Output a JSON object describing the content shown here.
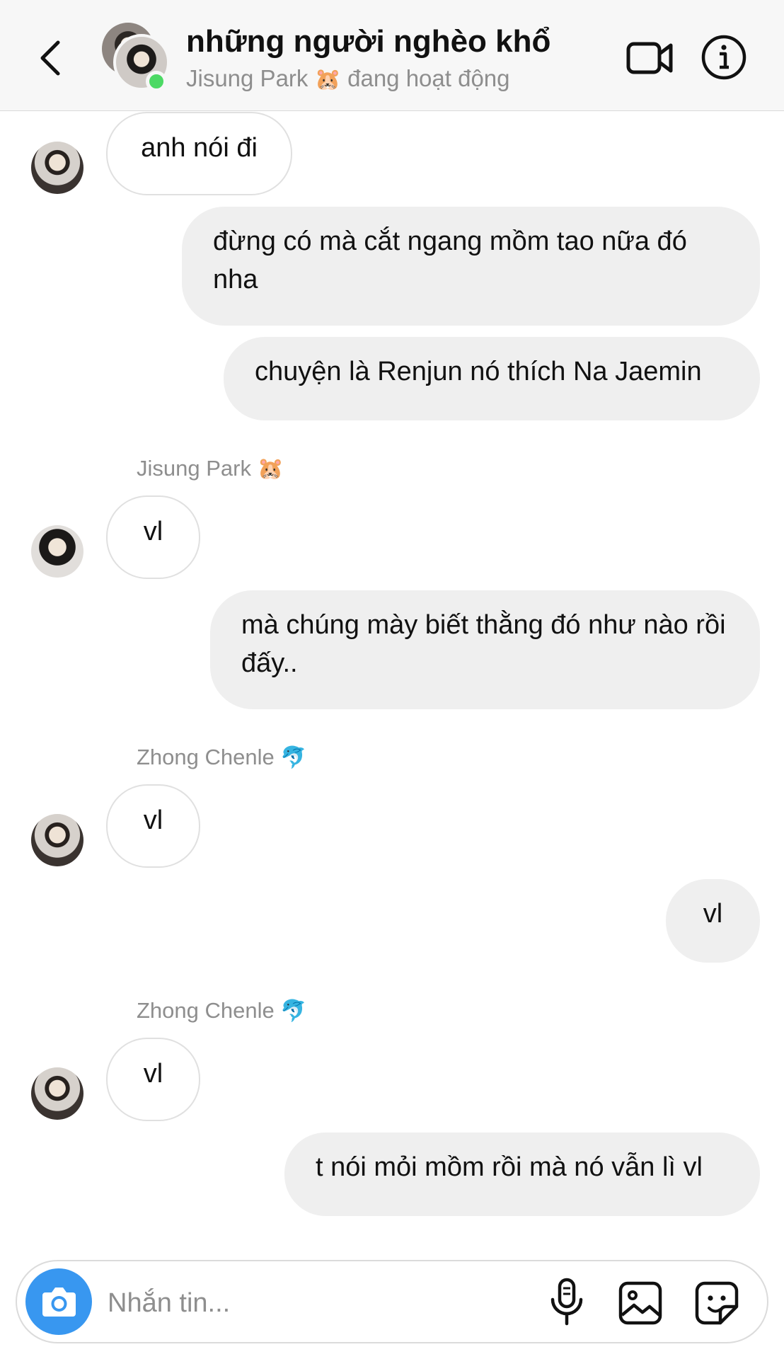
{
  "header": {
    "title": "những người nghèo khổ",
    "subtitle_name": "Jisung Park",
    "subtitle_emoji": "🐹",
    "subtitle_status": "đang hoạt động"
  },
  "messages": [
    {
      "side": "in",
      "text": "anh nói đi"
    },
    {
      "side": "out",
      "text": "đừng có mà cắt ngang mồm tao nữa đó nha"
    },
    {
      "side": "out",
      "text": "chuyện là Renjun nó thích Na Jaemin"
    },
    {
      "side": "in",
      "sender": "Jisung Park",
      "sender_emoji": "🐹",
      "text": "vl"
    },
    {
      "side": "out",
      "text": "mà chúng mày biết thằng đó như nào rồi đấy.."
    },
    {
      "side": "in",
      "sender": "Zhong Chenle",
      "sender_emoji": "🐬",
      "text": "vl"
    },
    {
      "side": "out",
      "text": "vl"
    },
    {
      "side": "in",
      "sender": "Zhong Chenle",
      "sender_emoji": "🐬",
      "text": "vl"
    },
    {
      "side": "out",
      "text": "t nói mỏi mồm rồi mà nó vẫn lì vl"
    }
  ],
  "composer": {
    "placeholder": "Nhắn tin..."
  },
  "icons": {
    "back": "chevron-left-icon",
    "video": "video-camera-icon",
    "info": "info-icon",
    "camera": "camera-icon",
    "mic": "microphone-icon",
    "gallery": "image-icon",
    "sticker": "sticker-icon"
  },
  "colors": {
    "accent": "#3897f0",
    "online": "#4cd964",
    "outgoing_bubble": "#efefef",
    "muted_text": "#8e8e8e"
  }
}
